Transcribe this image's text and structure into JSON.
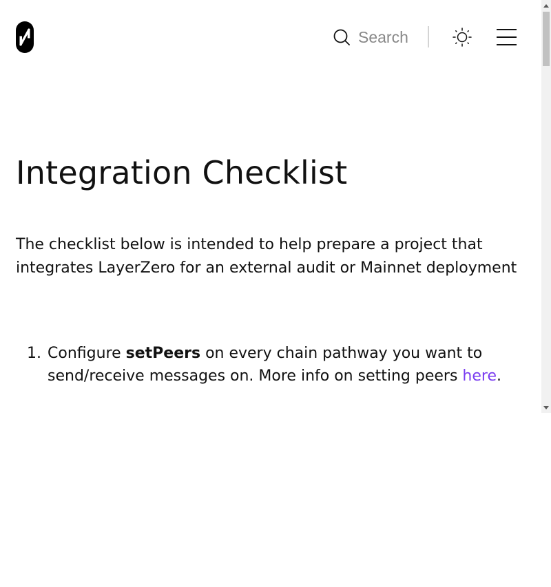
{
  "header": {
    "logo_icon": "layerzero-logo-icon",
    "search": {
      "icon": "search-icon",
      "placeholder": "Search"
    },
    "theme_toggle_icon": "sun-icon",
    "menu_icon": "hamburger-menu-icon"
  },
  "main": {
    "title": "Integration Checklist",
    "intro": "The checklist below is intended to help prepare a project that integrates LayerZero for an external audit or Mainnet deployment",
    "checklist": [
      {
        "number": "1.",
        "text_before": "Configure ",
        "strong": "setPeers",
        "text_middle": " on every chain pathway you want to send/receive messages on. More info on setting peers ",
        "link_label": "here",
        "text_after": "."
      }
    ]
  },
  "colors": {
    "text": "#111111",
    "link": "#7a3cf0",
    "placeholder": "#888888",
    "divider": "#d4d4d4"
  }
}
